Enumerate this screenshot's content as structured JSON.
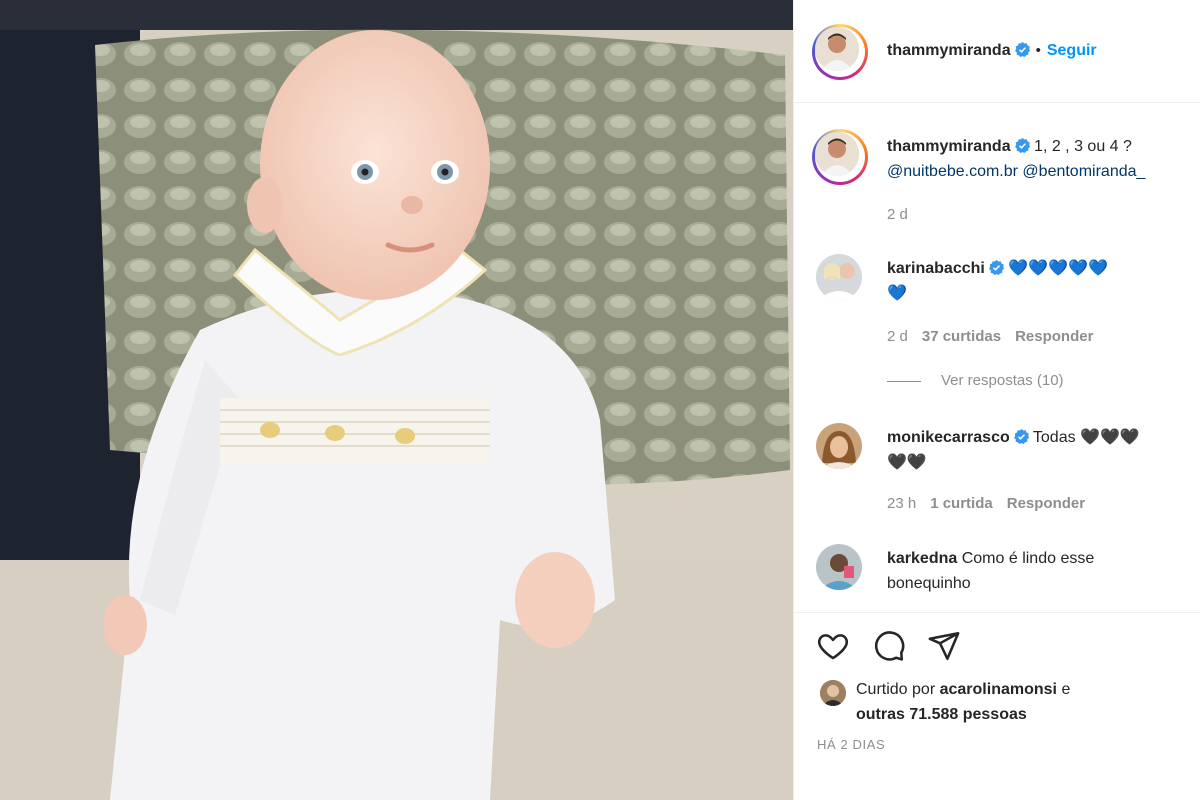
{
  "header": {
    "username": "thammymiranda",
    "follow_label": "Seguir",
    "separator": "•"
  },
  "caption": {
    "username": "thammymiranda",
    "text": "1, 2 , 3 ou 4 ?",
    "mentions": "@nuitbebe.com.br @bentomiranda_",
    "time": "2 d"
  },
  "comments": [
    {
      "username": "karinabacchi",
      "text_line1": "💙💙💙💙💙",
      "text_line2": "💙",
      "time": "2 d",
      "likes": "37 curtidas",
      "reply_label": "Responder"
    },
    {
      "username": "monikecarrasco",
      "text_line1": "Todas 🖤🖤🖤",
      "text_line2": "🖤🖤",
      "time": "23 h",
      "likes": "1 curtida",
      "reply_label": "Responder"
    },
    {
      "username": "karkedna",
      "text_line1": "Como é lindo esse",
      "text_line2": "bonequinho"
    }
  ],
  "view_replies": "Ver respostas (10)",
  "likes": {
    "prefix": "Curtido por",
    "user": "acarolinamonsi",
    "conj": "e",
    "others": "outras 71.588 pessoas"
  },
  "post_date": "HÁ 2 DIAS",
  "icons": [
    "heart-icon",
    "comment-icon",
    "share-icon",
    "verified-badge-icon"
  ],
  "colors": {
    "link": "#0095f6",
    "verified": "#3897f0",
    "muted": "#8e8e8e",
    "text": "#262626"
  }
}
